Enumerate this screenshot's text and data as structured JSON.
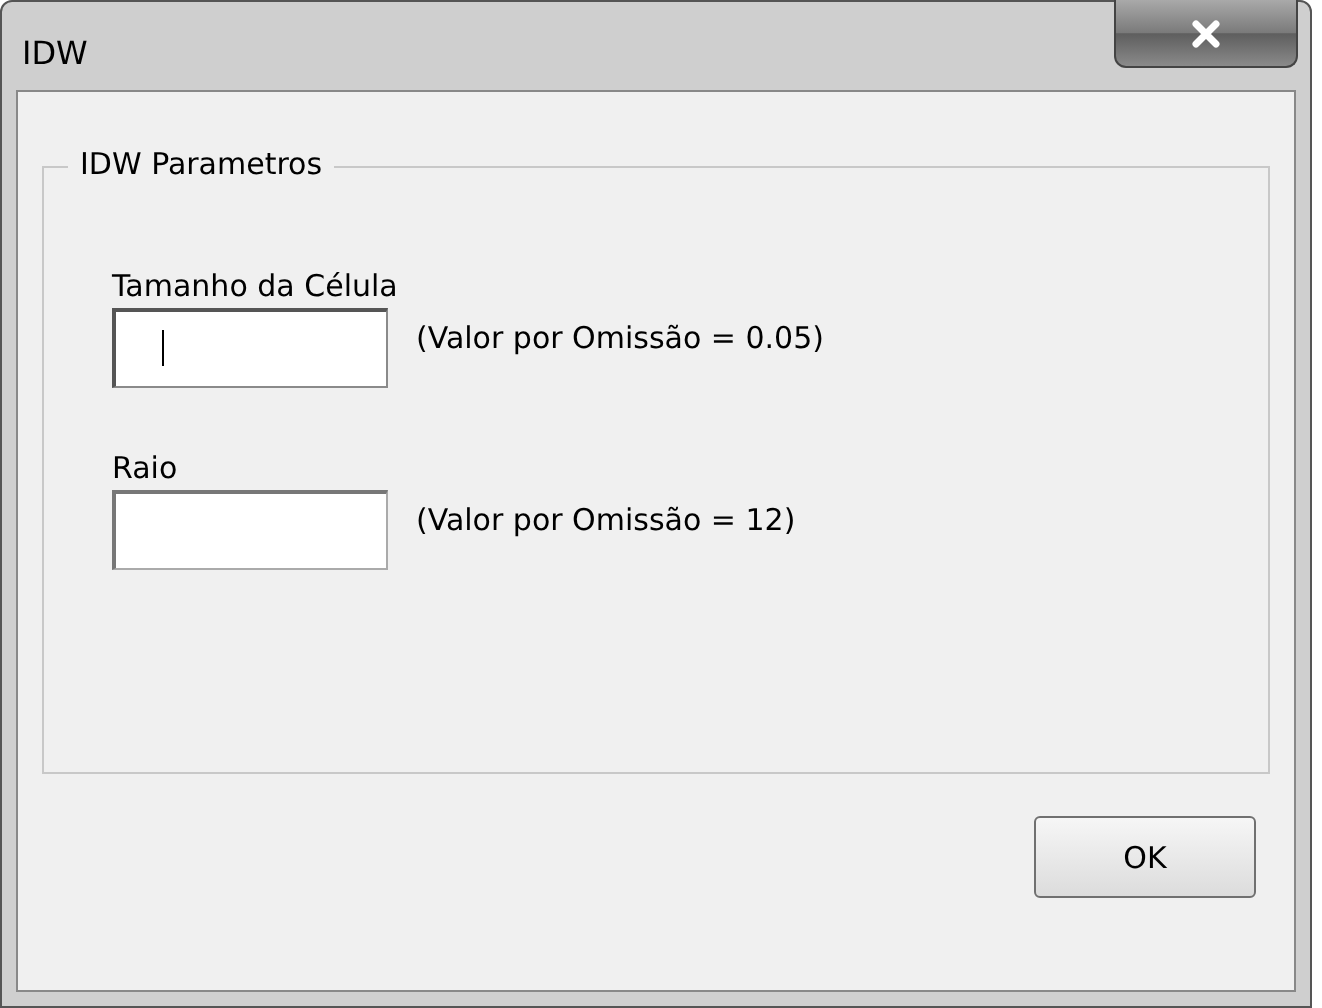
{
  "window": {
    "title": "IDW"
  },
  "group": {
    "title": "IDW Parametros",
    "fields": [
      {
        "label": "Tamanho da Célula",
        "hint": "(Valor por Omissão = 0.05)",
        "focused": true
      },
      {
        "label": "Raio",
        "hint": "(Valor por Omissão = 12)",
        "focused": false
      }
    ]
  },
  "buttons": [
    "OK"
  ]
}
